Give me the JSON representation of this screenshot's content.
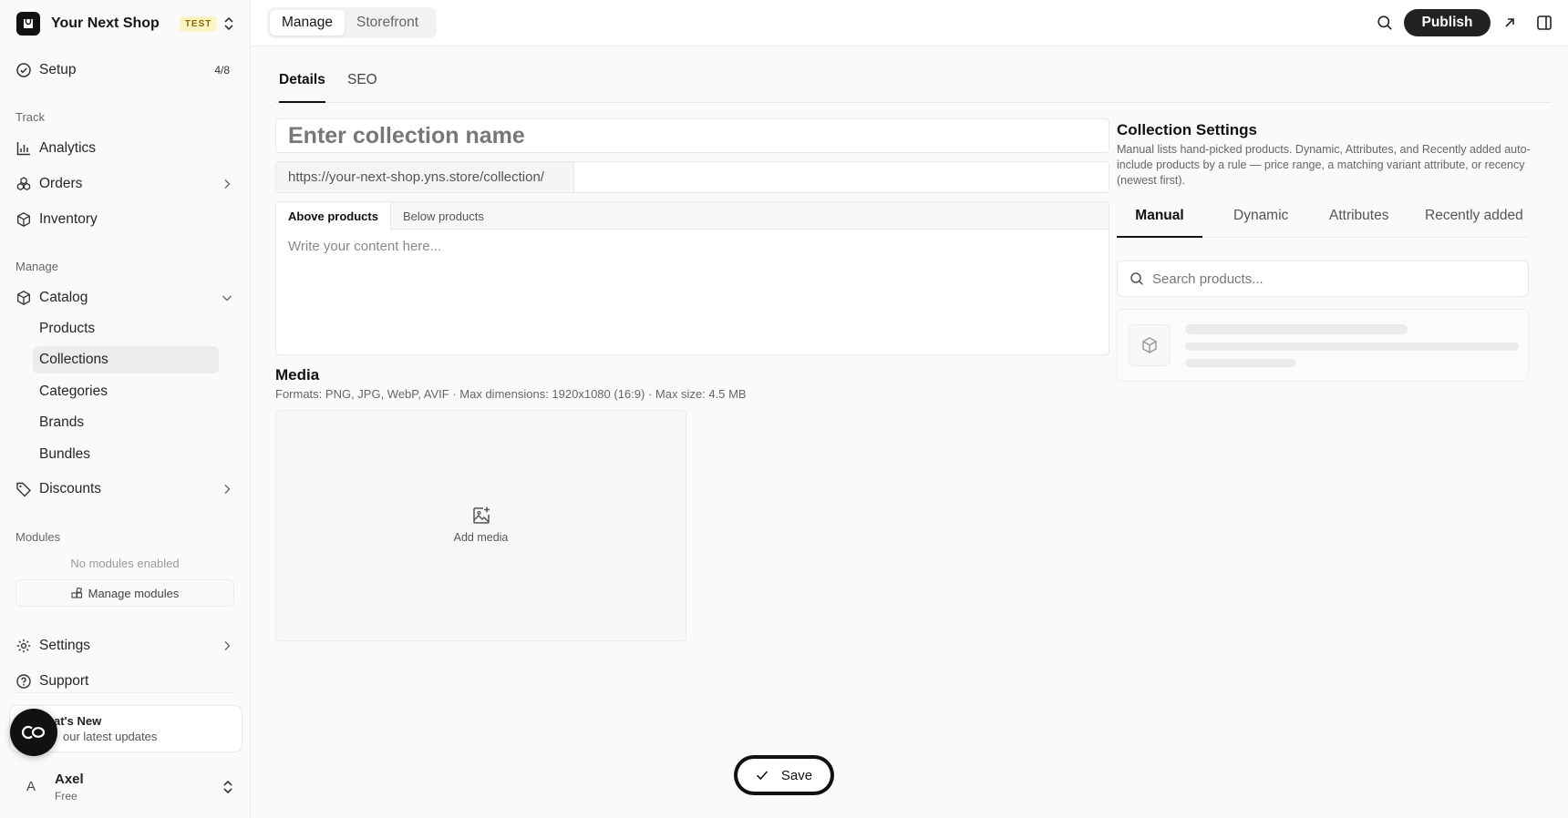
{
  "shop": {
    "name": "Your Next Shop",
    "badge": "TEST"
  },
  "topbar": {
    "modes": [
      "Manage",
      "Storefront"
    ],
    "active_mode": "Manage",
    "publish_label": "Publish"
  },
  "sidebar": {
    "setup": {
      "label": "Setup",
      "progress": "4/8"
    },
    "track_label": "Track",
    "track_items": [
      "Analytics",
      "Orders",
      "Inventory"
    ],
    "manage_label": "Manage",
    "catalog_label": "Catalog",
    "catalog_children": [
      "Products",
      "Collections",
      "Categories",
      "Brands",
      "Bundles"
    ],
    "active_child": "Collections",
    "discounts_label": "Discounts",
    "modules_label": "Modules",
    "no_modules": "No modules enabled",
    "manage_modules": "Manage modules",
    "settings_label": "Settings",
    "support_label": "Support",
    "whats_new_title": "at's New",
    "whats_new_sub": "our latest updates",
    "user": {
      "initial": "A",
      "name": "Axel",
      "plan": "Free"
    }
  },
  "page": {
    "tabs": [
      "Details",
      "SEO"
    ],
    "active_tab": "Details",
    "name_placeholder": "Enter collection name",
    "slug_prefix": "https://your-next-shop.yns.store/collection/",
    "editor_tabs": [
      "Above products",
      "Below products"
    ],
    "editor_placeholder": "Write your content here...",
    "media": {
      "title": "Media",
      "subtitle": "Formats: PNG, JPG, WebP, AVIF · Max dimensions: 1920x1080 (16:9) · Max size: 4.5 MB",
      "add_label": "Add media"
    }
  },
  "collection_settings": {
    "title": "Collection Settings",
    "description": "Manual lists hand-picked products. Dynamic, Attributes, and Recently added auto-include products by a rule — price range, a matching variant attribute, or recency (newest first).",
    "tabs": [
      "Manual",
      "Dynamic",
      "Attributes",
      "Recently added"
    ],
    "active_tab": "Manual",
    "search_placeholder": "Search products..."
  },
  "save_label": "Save",
  "icons": [
    "store-icon",
    "chevron-updown-icon",
    "check-circle-icon",
    "bar-chart-icon",
    "orders-icon",
    "box-icon",
    "tag-icon",
    "gear-icon",
    "help-circle-icon",
    "search-icon",
    "external-link-icon",
    "panel-icon",
    "image-plus-icon",
    "check-icon"
  ]
}
